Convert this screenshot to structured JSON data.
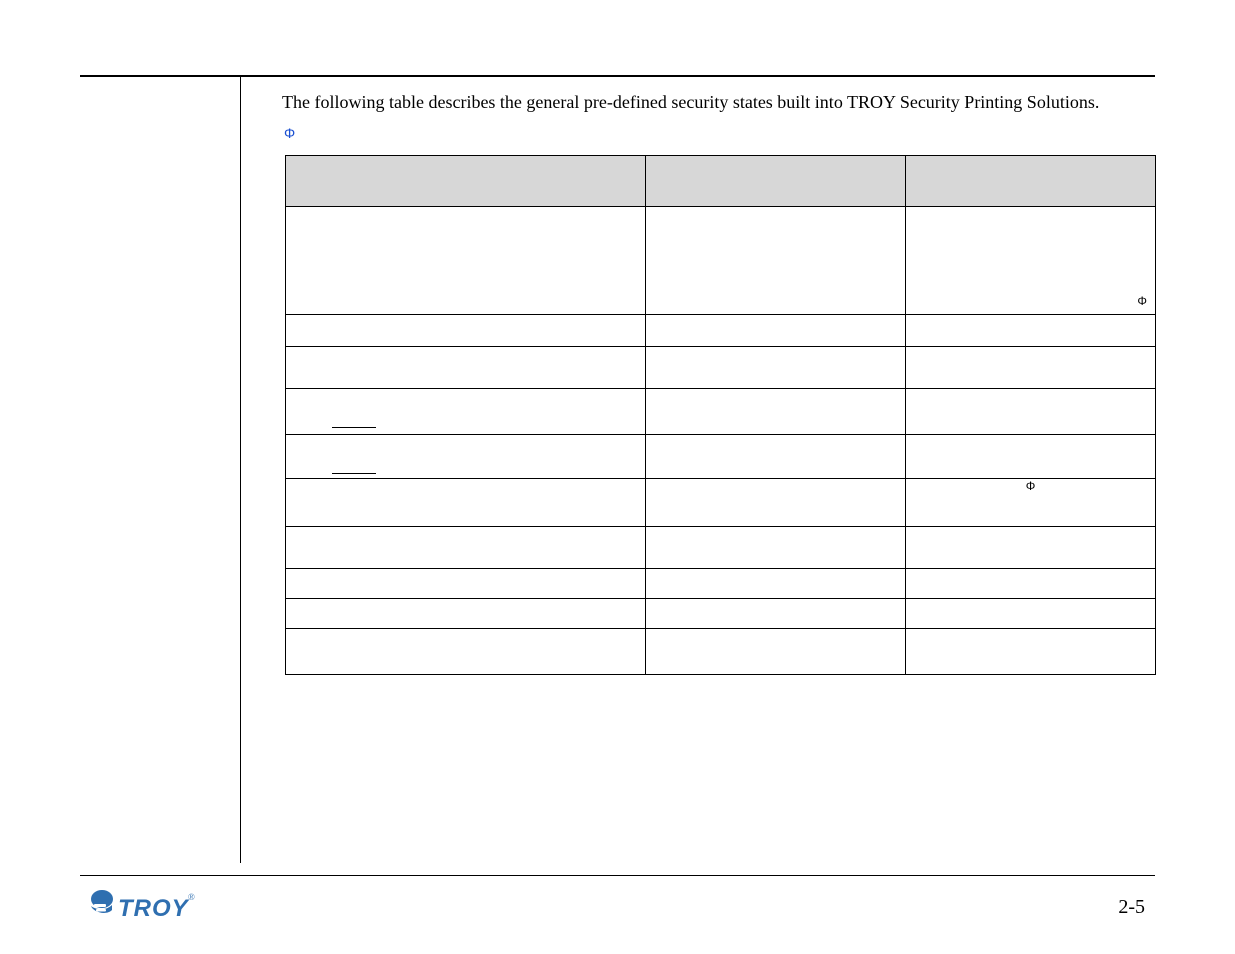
{
  "intro": "The following table describes the general pre-defined security states built into TROY Security Printing Solutions.",
  "phi_glyph": "Φ",
  "page_number": "2-5",
  "logo": {
    "text": "TROY",
    "reg": "®"
  }
}
